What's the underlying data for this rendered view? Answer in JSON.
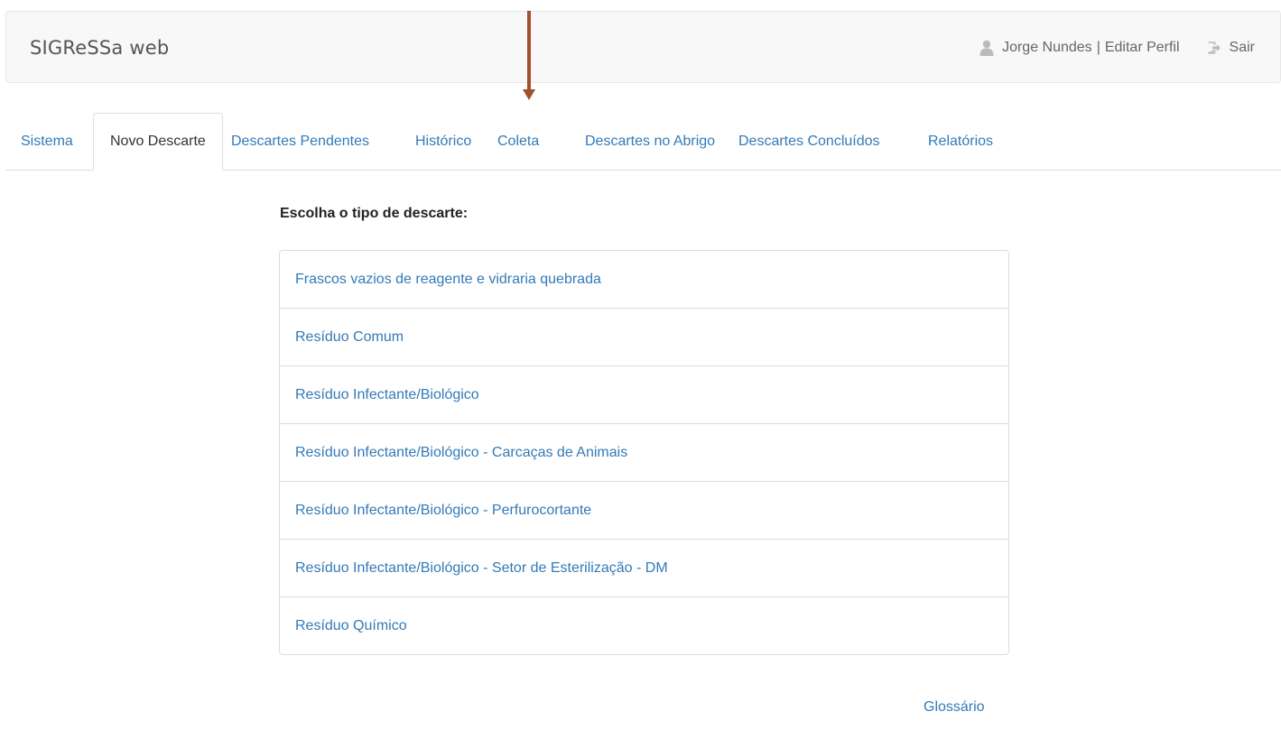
{
  "navbar": {
    "brand": "SIGReSSa web",
    "user_icon": "user-icon",
    "user_name": "Jorge Nundes",
    "separator": "|",
    "edit_profile": "Editar Perfil",
    "logout_icon": "logout-icon",
    "logout": "Sair"
  },
  "annotation": {
    "arrow_color": "#a0522d",
    "arrow_icon": "down-arrow-annotation"
  },
  "tabs": [
    {
      "label": "Sistema",
      "active": false
    },
    {
      "label": "Novo Descarte",
      "active": true
    },
    {
      "label": "Descartes Pendentes",
      "active": false
    },
    {
      "label": "Histórico",
      "active": false
    },
    {
      "label": "Coleta",
      "active": false
    },
    {
      "label": "Descartes no Abrigo",
      "active": false
    },
    {
      "label": "Descartes Concluídos",
      "active": false
    },
    {
      "label": "Relatórios",
      "active": false
    }
  ],
  "main": {
    "heading": "Escolha o tipo de descarte:",
    "options": [
      "Frascos vazios de reagente e vidraria quebrada",
      "Resíduo Comum",
      "Resíduo Infectante/Biológico",
      "Resíduo Infectante/Biológico - Carcaças de Animais",
      "Resíduo Infectante/Biológico - Perfurocortante",
      "Resíduo Infectante/Biológico - Setor de Esterilização - DM",
      "Resíduo Químico"
    ]
  },
  "footer": {
    "glossary": "Glossário"
  },
  "colors": {
    "link": "#337ab7",
    "navbar_bg": "#f8f8f8",
    "border": "#dddddd"
  }
}
